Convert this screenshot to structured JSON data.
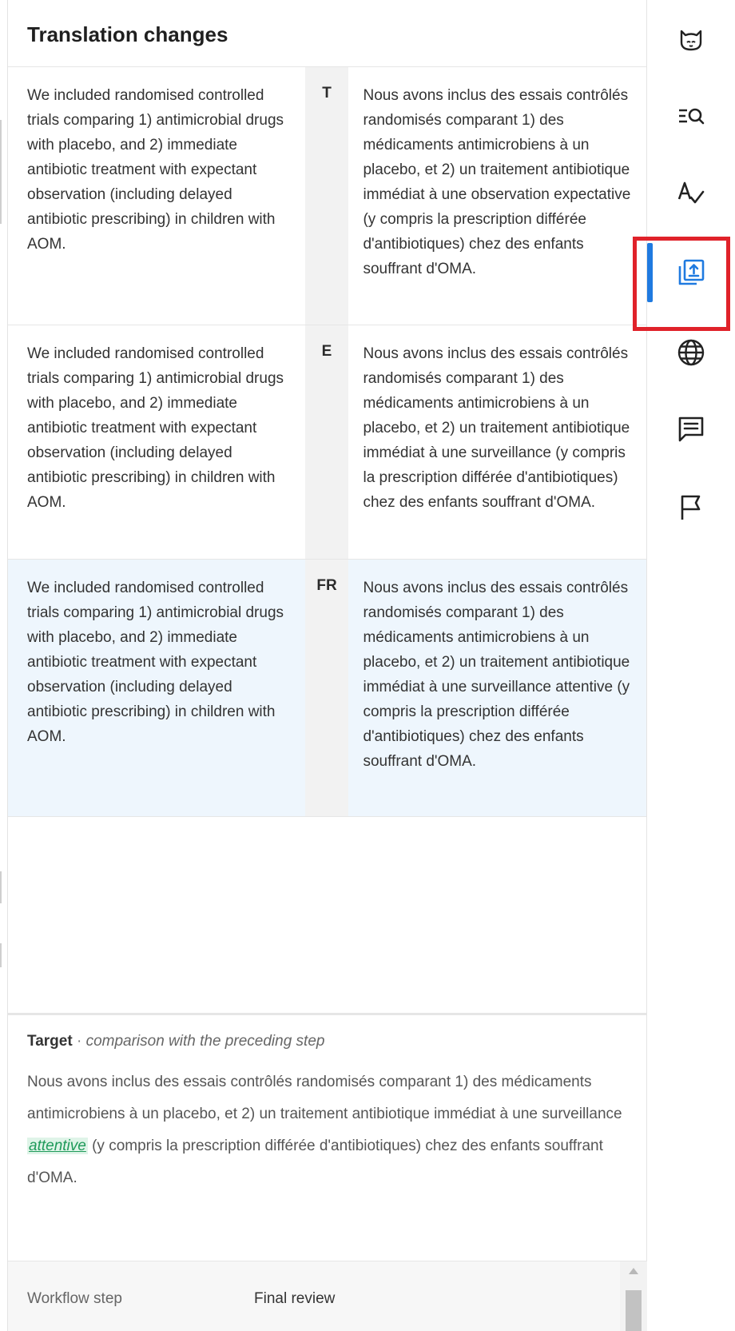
{
  "panel": {
    "title": "Translation changes"
  },
  "rows": [
    {
      "source": "We included randomised controlled trials comparing 1) antimicrobial drugs with placebo, and 2) immediate antibiotic treatment with expectant observation (including delayed antibiotic prescribing) in children with AOM.",
      "step": "T",
      "target": "Nous avons inclus des essais contrôlés randomisés comparant 1) des médicaments antimicrobiens à un placebo, et 2) un traitement antibiotique immédiat à une observation expectative (y compris la prescription différée d'antibiotiques) chez des enfants souffrant d'OMA."
    },
    {
      "source": "We included randomised controlled trials comparing 1) antimicrobial drugs with placebo, and 2) immediate antibiotic treatment with expectant observation (including delayed antibiotic prescribing) in children with AOM.",
      "step": "E",
      "target": "Nous avons inclus des essais contrôlés randomisés comparant 1) des médicaments antimicrobiens à un placebo, et 2) un traitement antibiotique immédiat à une surveillance (y compris la prescription différée d'antibiotiques) chez des enfants souffrant d'OMA."
    },
    {
      "source": "We included randomised controlled trials comparing 1) antimicrobial drugs with placebo, and 2) immediate antibiotic treatment with expectant observation (including delayed antibiotic prescribing) in children with AOM.",
      "step": "FR",
      "target": "Nous avons inclus des essais contrôlés randomisés comparant 1) des médicaments antimicrobiens à un placebo, et 2) un traitement antibiotique immédiat à une surveillance attentive (y compris la prescription différée d'antibiotiques) chez des enfants souffrant d'OMA."
    }
  ],
  "detail": {
    "label": "Target",
    "separator": " · ",
    "note": "comparison with the preceding step",
    "text_before": "Nous avons inclus des essais contrôlés randomisés comparant 1) des médicaments antimicrobiens à un placebo, et 2) un traitement antibiotique immédiat à une surveillance ",
    "inserted": "attentive",
    "text_after": " (y compris la prescription différée d'antibiotiques) chez des enfants souffrant d'OMA."
  },
  "meta": {
    "key": "Workflow step",
    "value": "Final review"
  },
  "toolbar": {
    "items": [
      "cat-icon",
      "search-list-icon",
      "spellcheck-icon",
      "translation-changes-icon",
      "globe-icon",
      "comment-icon",
      "flag-icon"
    ],
    "active": "translation-changes-icon",
    "accent": "#1f7ae0",
    "highlight": "#e0222a"
  }
}
